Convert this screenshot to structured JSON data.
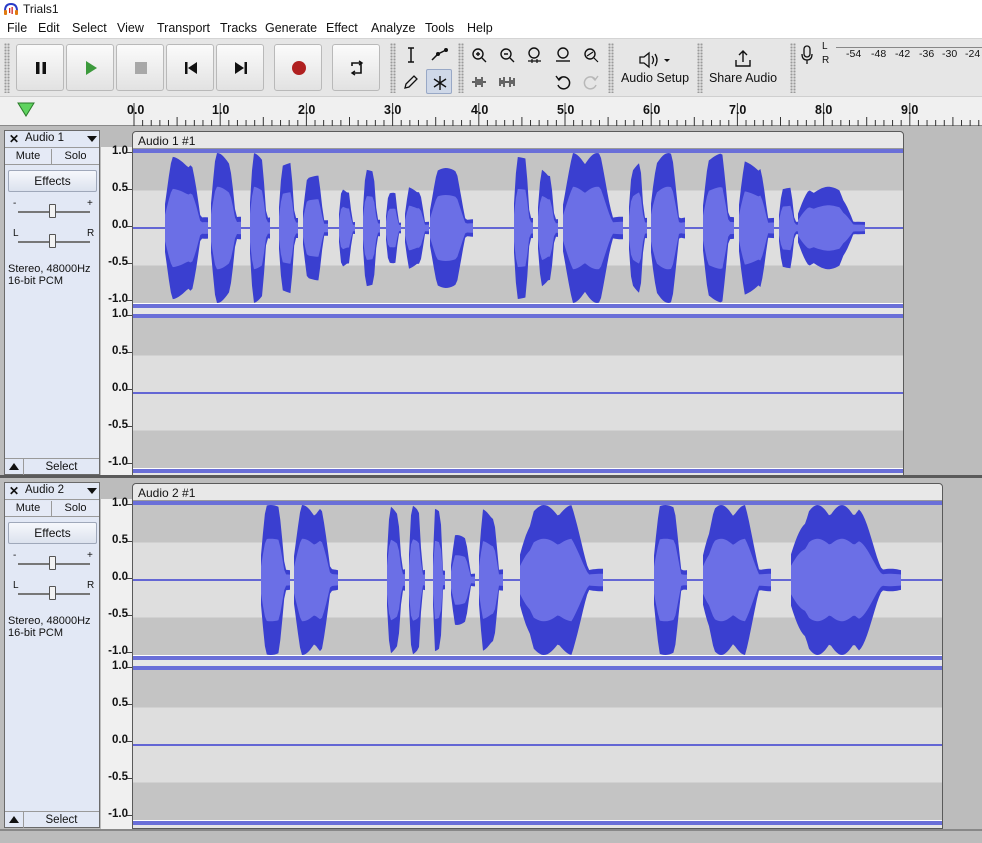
{
  "window": {
    "title": "Trials1"
  },
  "menu": [
    "File",
    "Edit",
    "Select",
    "View",
    "Transport",
    "Tracks",
    "Generate",
    "Effect",
    "Analyze",
    "Tools",
    "Help"
  ],
  "toolbar": {
    "audio_setup_label": "Audio Setup",
    "share_audio_label": "Share Audio",
    "meter_ticks": [
      "-54",
      "-48",
      "-42",
      "-36",
      "-30",
      "-24"
    ],
    "meter_l": "L",
    "meter_r": "R"
  },
  "ruler": {
    "ticks": [
      "0.0",
      "1.0",
      "2.0",
      "3.0",
      "4.0",
      "5.0",
      "6.0",
      "7.0",
      "8.0",
      "9.0"
    ]
  },
  "tracks": [
    {
      "name": "Audio 1",
      "clip_name": "Audio 1 #1",
      "mute_label": "Mute",
      "solo_label": "Solo",
      "effects_label": "Effects",
      "gain_minus": "-",
      "gain_plus": "+",
      "pan_left": "L",
      "pan_right": "R",
      "info_line1": "Stereo, 48000Hz",
      "info_line2": "16-bit PCM",
      "select_label": "Select",
      "scale_labels": [
        "1.0",
        "0.5",
        "0.0",
        "-0.5",
        "-1.0"
      ]
    },
    {
      "name": "Audio 2",
      "clip_name": "Audio 2 #1",
      "mute_label": "Mute",
      "solo_label": "Solo",
      "effects_label": "Effects",
      "gain_minus": "-",
      "gain_plus": "+",
      "pan_left": "L",
      "pan_right": "R",
      "info_line1": "Stereo, 48000Hz",
      "info_line2": "16-bit PCM",
      "select_label": "Select",
      "scale_labels": [
        "1.0",
        "0.5",
        "0.0",
        "-0.5",
        "-1.0"
      ]
    }
  ],
  "colors": {
    "waveform_outer": "#3a3fd0",
    "waveform_rms": "#6b6fe6",
    "record": "#b02020",
    "play": "#3c9a3c"
  }
}
